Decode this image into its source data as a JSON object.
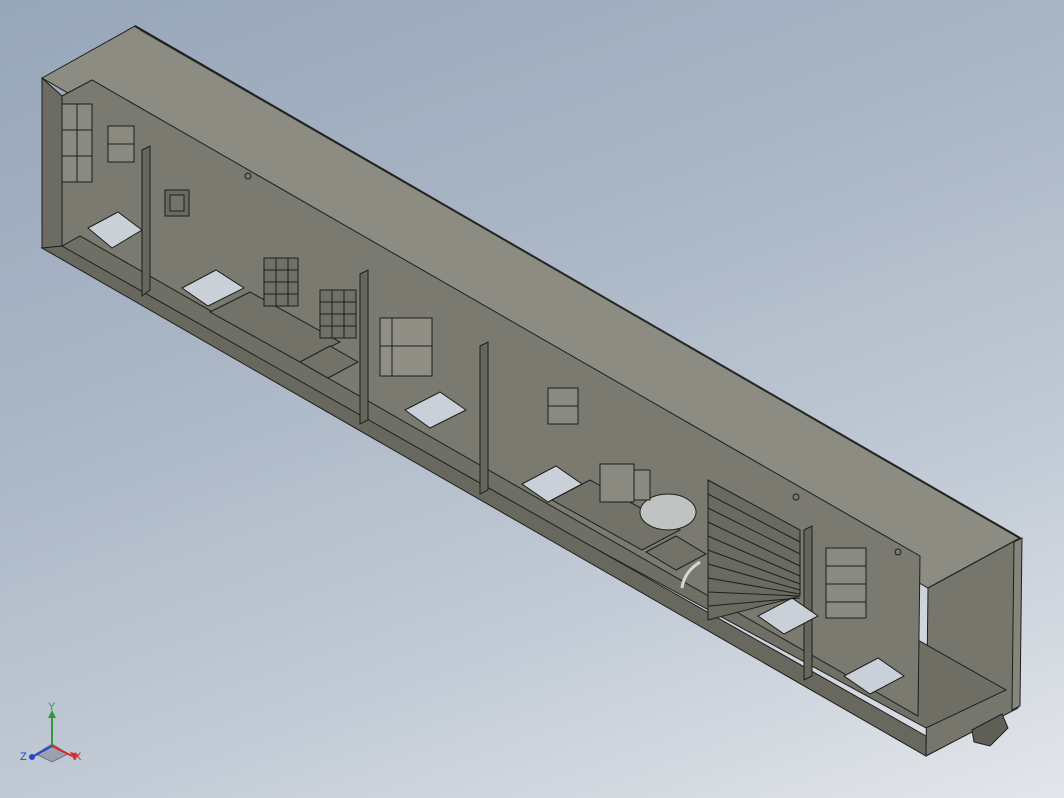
{
  "viewport": {
    "background_top": "#97a6b9",
    "background_bottom": "#e3e6ea"
  },
  "model": {
    "body_color": "#7b7b72",
    "top_face_color": "#8c8c82",
    "floor_color": "#6f6f66",
    "wall_color": "#74746b",
    "edge_color": "#1f1f1c",
    "window_color": "#c9d0d8"
  },
  "triad": {
    "x_label": "X",
    "y_label": "Y",
    "z_label": "Z",
    "x_color": "#d8262b",
    "y_color": "#2e9b36",
    "z_color": "#2548c9"
  }
}
